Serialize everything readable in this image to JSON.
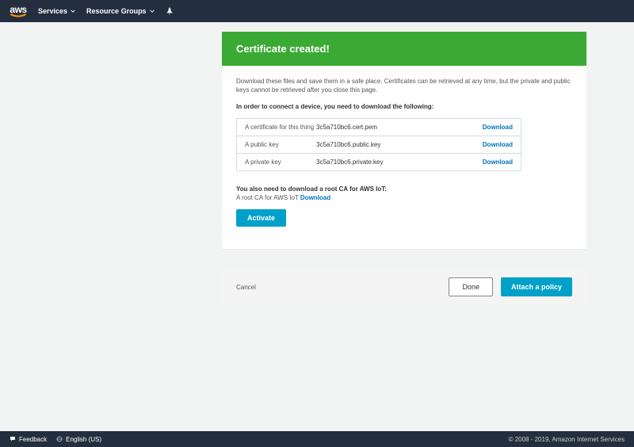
{
  "topnav": {
    "services": "Services",
    "resource_groups": "Resource Groups"
  },
  "banner": {
    "title": "Certificate created!"
  },
  "body": {
    "help": "Download these files and save them in a safe place. Certificates can be retrieved at any time, but the private and public keys cannot be retrieved after you close this page.",
    "instruction": "In order to connect a device, you need to download the following:",
    "download_label": "Download",
    "files": [
      {
        "desc": "A certificate for this thing",
        "file": "3c5a710bc6.cert.pem"
      },
      {
        "desc": "A public key",
        "file": "3c5a710bc6.public.key"
      },
      {
        "desc": "A private key",
        "file": "3c5a710bc6.private.key"
      }
    ],
    "root_ca_title": "You also need to download a root CA for AWS IoT:",
    "root_ca_sub_prefix": "A root CA for AWS IoT ",
    "root_ca_link": "Download",
    "activate": "Activate"
  },
  "footer": {
    "cancel": "Cancel",
    "done": "Done",
    "attach": "Attach a policy"
  },
  "bottombar": {
    "feedback": "Feedback",
    "language": "English (US)",
    "copyright": "© 2008 - 2019, Amazon Internet Services"
  }
}
